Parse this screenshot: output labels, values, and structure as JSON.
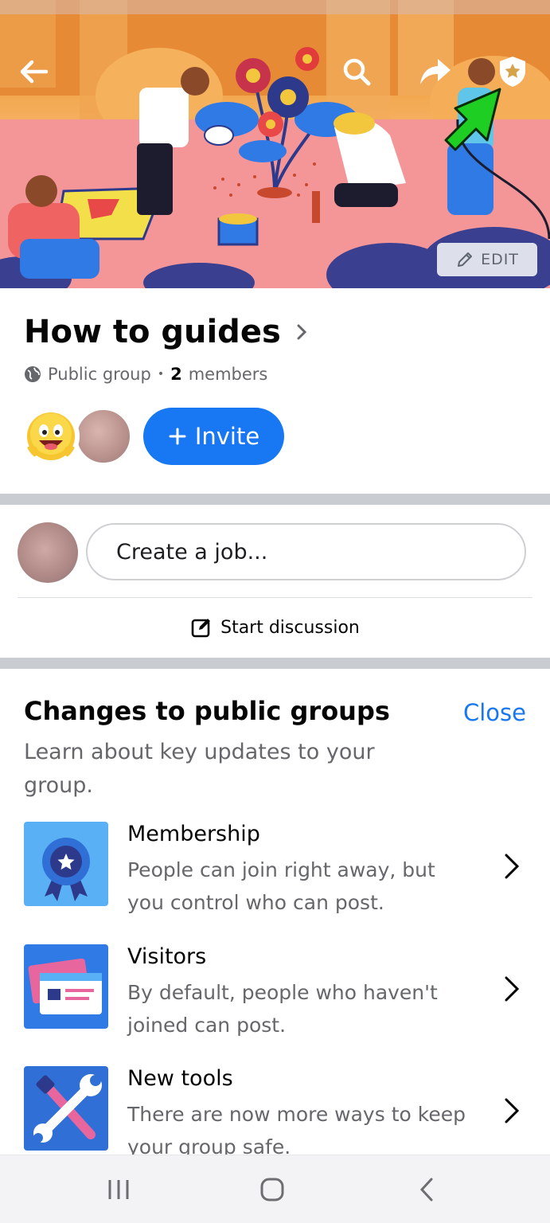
{
  "cover": {
    "edit_label": "EDIT"
  },
  "group": {
    "name": "How to guides",
    "privacy": "Public group",
    "separator": "•",
    "member_count": "2",
    "members_label": "members",
    "invite_label": "Invite"
  },
  "composer": {
    "placeholder": "Create a job...",
    "discussion_label": "Start discussion"
  },
  "changes": {
    "title": "Changes to public groups",
    "close_label": "Close",
    "subtitle": "Learn about key updates to your group.",
    "items": [
      {
        "title": "Membership",
        "desc": "People can join right away, but you control who can post."
      },
      {
        "title": "Visitors",
        "desc": "By default, people who haven't joined can post."
      },
      {
        "title": "New tools",
        "desc": "There are now more ways to keep your group safe."
      }
    ]
  },
  "colors": {
    "accent": "#1877f2",
    "secondary_text": "#65676b",
    "divider": "#c9ccd1"
  },
  "icons": [
    "back-arrow-icon",
    "search-icon",
    "share-icon",
    "admin-shield-icon",
    "pencil-icon",
    "globe-icon",
    "chevron-right-icon",
    "plus-icon",
    "edit-square-icon",
    "recents-icon",
    "home-icon",
    "back-icon"
  ]
}
